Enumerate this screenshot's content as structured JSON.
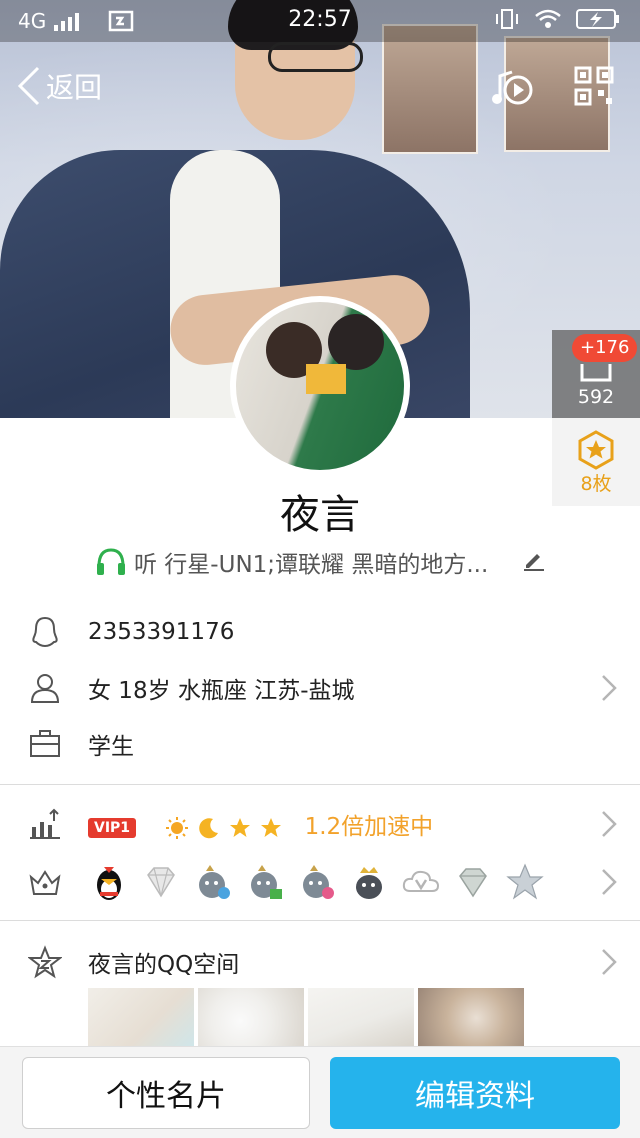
{
  "status_bar": {
    "network": "4G",
    "time": "22:57"
  },
  "nav": {
    "back_label": "返回"
  },
  "side": {
    "likes_badge": "+176",
    "likes_count": "592",
    "badge_count": "8枚"
  },
  "profile": {
    "name": "夜言",
    "signature": "听 行星-UN1;谭联耀 黑暗的地方..."
  },
  "info": {
    "qq_number": "2353391176",
    "personal": "女  18岁  水瓶座  江苏-盐城",
    "occupation": "学生"
  },
  "level": {
    "vip_label": "VIP1",
    "speed_text": "1.2倍加速中"
  },
  "qzone": {
    "title": "夜言的QQ空间"
  },
  "bottom": {
    "card_button": "个性名片",
    "edit_button": "编辑资料"
  },
  "colors": {
    "accent_blue": "#25b3ec",
    "vip_red": "#e53b2e",
    "speed_orange": "#f2a22b",
    "badge_red": "#f04a35"
  }
}
